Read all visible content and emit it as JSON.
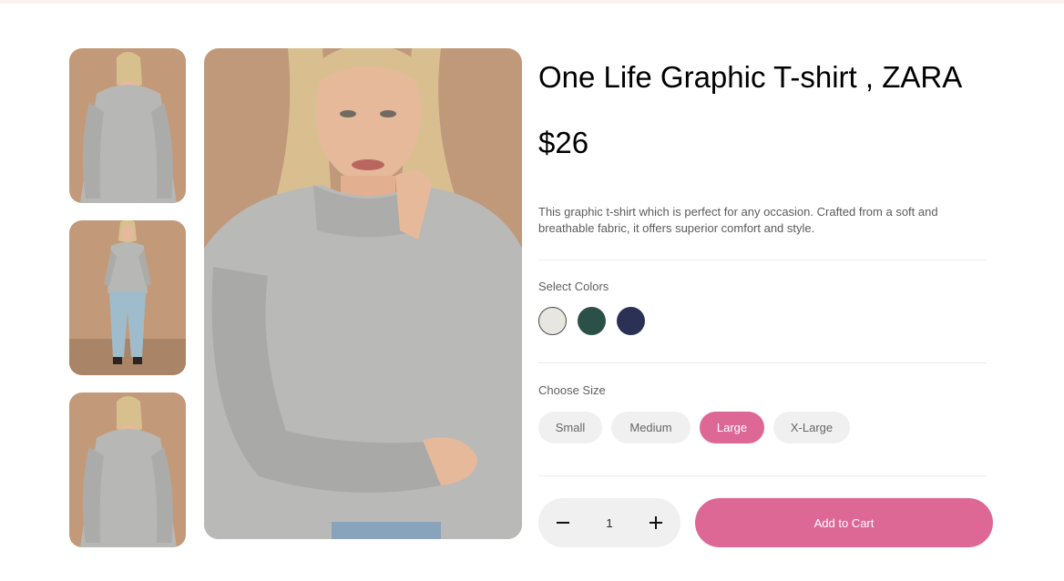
{
  "product": {
    "title": "One Life Graphic T-shirt , ZARA",
    "price": "$26",
    "description": "This graphic t-shirt which is perfect for any occasion. Crafted from a soft and breathable fabric, it offers superior comfort and style."
  },
  "gallery": {
    "thumbnails": [
      {
        "name": "back view"
      },
      {
        "name": "full body front view"
      },
      {
        "name": "back view"
      }
    ],
    "main": {
      "name": "front close-up"
    },
    "background_color": "#c0997a",
    "sweater_color": "#b9bab8"
  },
  "colors": {
    "label": "Select Colors",
    "options": [
      {
        "hex": "#e8e6e1",
        "selected": true
      },
      {
        "hex": "#2b5048",
        "selected": false
      },
      {
        "hex": "#2b3155",
        "selected": false
      }
    ]
  },
  "sizes": {
    "label": "Choose Size",
    "options": [
      "Small",
      "Medium",
      "Large",
      "X-Large"
    ],
    "selected": "Large"
  },
  "cart": {
    "quantity": "1",
    "add_label": "Add to Cart"
  },
  "theme": {
    "accent": "#dd6896"
  }
}
